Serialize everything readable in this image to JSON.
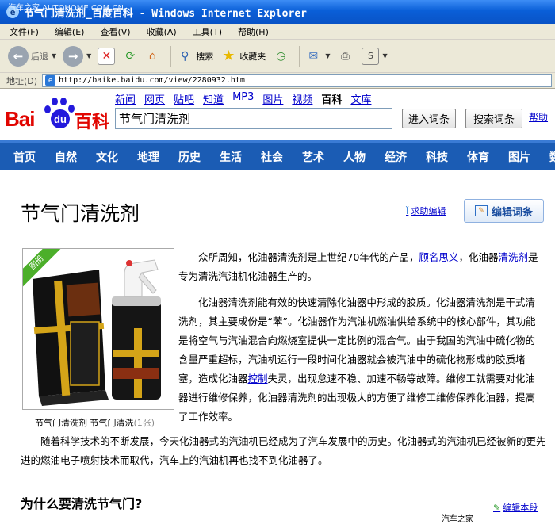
{
  "window": {
    "title": "节气门清洗剂_百度百科 - Windows Internet Explorer",
    "watermark_top": "汽车之家 AUTOHOME.COM.CN"
  },
  "menubar": {
    "items": [
      "文件(F)",
      "编辑(E)",
      "查看(V)",
      "收藏(A)",
      "工具(T)",
      "帮助(H)"
    ]
  },
  "toolbar": {
    "back_label": "后退",
    "search_label": "搜索",
    "favorites_label": "收藏夹"
  },
  "addressbar": {
    "label": "地址(D)",
    "url": "http://baike.baidu.com/view/2280932.htm"
  },
  "baidu": {
    "logo_bai": "Bai",
    "logo_du": "du",
    "logo_baike": "百科",
    "nav": [
      "新闻",
      "网页",
      "贴吧",
      "知道",
      "MP3",
      "图片",
      "视频",
      "百科",
      "文库"
    ],
    "search_value": "节气门清洗剂",
    "enter_entry_btn": "进入词条",
    "search_entry_btn": "搜索词条",
    "help_link": "帮助"
  },
  "categories": [
    "首页",
    "自然",
    "文化",
    "地理",
    "历史",
    "生活",
    "社会",
    "艺术",
    "人物",
    "经济",
    "科技",
    "体育",
    "图片",
    "数"
  ],
  "article": {
    "title": "节气门清洗剂",
    "help_edit": "求助编辑",
    "edit_entry": "编辑词条",
    "image_ribbon": "图册",
    "caption": "节气门清洗剂 节气门清洗",
    "caption_count": "(1张)",
    "p1_a": "众所周知，化油器清洗剂是上世纪70年代的产品，",
    "p1_link1": "顾名思义",
    "p1_b": "，化油器",
    "p1_link2": "清洗",
    "p1_link2b": "剂",
    "p1_c": "是专为清洗汽油机化油器生产的。",
    "p2_a": "化油器清洗剂能有效的快速清除化油器中形成的胶质。化油器清洗剂是干式清洗剂，其主要成份是“苯”。化油器作为汽油机燃油供给系统中的核心部件，其功能是将空气与汽油混合向燃烧室提供一定比例的混合气。由于我国的汽油中硫化物的含量严重超标，汽油机运行一段时间化油器就会被汽油中的硫化物形成的胶质堵塞，造成化油器",
    "p2_link": "控制",
    "p2_b": "失灵，出现怠速不稳、加速不畅等故障。维修工就需要对化油器进行维修保养，化油器清洗剂的出现极大的方便了维修工维修保养化油器，提高了工作效率。",
    "p3": "随着科学技术的不断发展，今天化油器式的汽油机已经成为了汽车发展中的历史。化油器式的汽油机已经被新的更先进的燃油电子喷射技术而取代，汽车上的汽油机再也找不到化油器了。",
    "section_title": "为什么要清洗节气门?",
    "edit_section": "编辑本段"
  },
  "footer_watermark": "汽车之家 AUTOHOME.COM.CN"
}
